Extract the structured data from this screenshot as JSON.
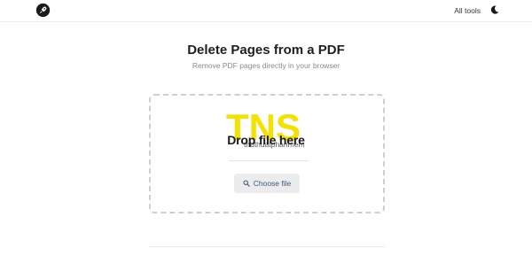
{
  "header": {
    "logo_icon": "rocket-logo-icon",
    "all_tools_label": "All tools",
    "theme_icon": "moon-icon"
  },
  "main": {
    "title": "Delete Pages from a PDF",
    "subtitle": "Remove PDF pages directly in your browser",
    "dropzone": {
      "prompt": "Drop file here",
      "button_label": "Choose file",
      "button_icon": "search-icon"
    }
  },
  "watermark": {
    "top_text": "TNS",
    "bottom_text": "thuthuatphanmem"
  },
  "colors": {
    "watermark_yellow": "#f2e200",
    "button_bg": "#ececec",
    "button_text": "#3d5a80",
    "dashed_border": "#cfcfcf"
  }
}
